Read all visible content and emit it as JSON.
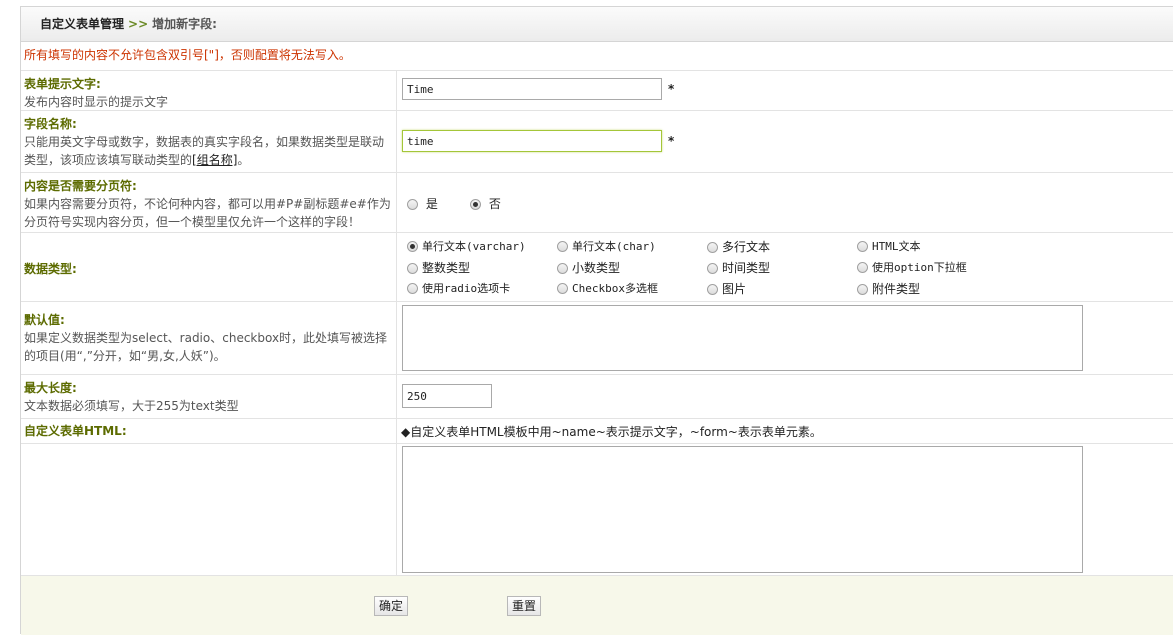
{
  "breadcrumb": {
    "root": "自定义表单管理",
    "separator": ">>",
    "current": "增加新字段:"
  },
  "notice": "所有填写的内容不允许包含双引号[\"]，否则配置将无法写入。",
  "fields": {
    "label_text": {
      "title": "表单提示文字:",
      "desc": "发布内容时显示的提示文字",
      "value": "Time",
      "required": "*"
    },
    "field_name": {
      "title": "字段名称:",
      "desc": "只能用英文字母或数字，数据表的真实字段名，如果数据类型是联动类型，该项应该填写联动类型的",
      "desc_link": "[组名称]",
      "desc_end": "。",
      "value": "time",
      "required": "*"
    },
    "paging": {
      "title": "内容是否需要分页符:",
      "desc": "如果内容需要分页符，不论何种内容，都可以用#P#副标题#e#作为分页符号实现内容分页，但一个模型里仅允许一个这样的字段！",
      "options": [
        "是",
        "否"
      ],
      "selected": "否"
    },
    "data_type": {
      "title": "数据类型:",
      "options": [
        "单行文本(varchar)",
        "单行文本(char)",
        "多行文本",
        "HTML文本",
        "整数类型",
        "小数类型",
        "时间类型",
        "使用option下拉框",
        "使用radio选项卡",
        "Checkbox多选框",
        "图片",
        "附件类型"
      ],
      "selected": "单行文本(varchar)"
    },
    "default_value": {
      "title": "默认值:",
      "desc": "如果定义数据类型为select、radio、checkbox时，此处填写被选择的项目(用“,”分开，如“男,女,人妖”)。",
      "value": ""
    },
    "max_length": {
      "title": "最大长度:",
      "desc": "文本数据必须填写，大于255为text类型",
      "value": "250"
    },
    "custom_html": {
      "title": "自定义表单HTML:",
      "hint": "◆自定义表单HTML模板中用~name~表示提示文字，~form~表示表单元素。",
      "value": ""
    }
  },
  "buttons": {
    "submit": "确定",
    "reset": "重置"
  }
}
